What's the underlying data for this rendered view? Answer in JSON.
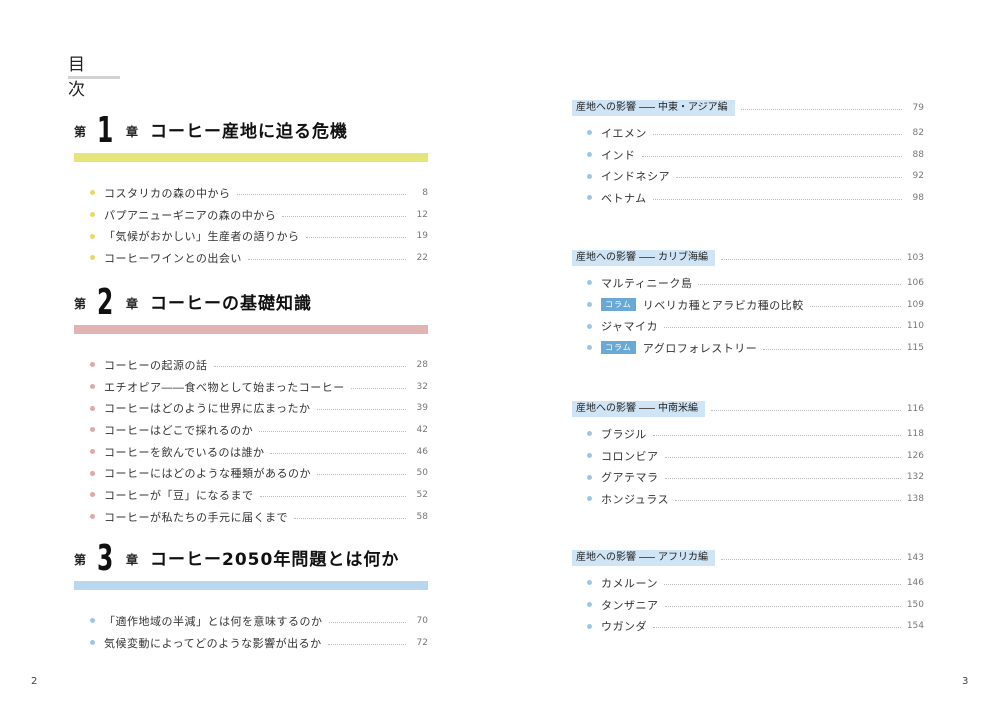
{
  "toc_title": "目 次",
  "colors": {
    "ch1": "#e6e57a",
    "ch2": "#e2b3b3",
    "ch3": "#b9d8ef",
    "ch1_dot": "#e8d86a",
    "ch2_dot": "#e2a6a6",
    "ch3_dot": "#9cc6e8",
    "region_bg": "#cfe4f4",
    "badge": "#6aa8d6"
  },
  "chapters": [
    {
      "dai": "第",
      "num": "1",
      "sho": "章",
      "title": "コーヒー産地に迫る危機",
      "items": [
        {
          "label": "コスタリカの森の中から",
          "page": "8"
        },
        {
          "label": "パプアニューギニアの森の中から",
          "page": "12"
        },
        {
          "label": "「気候がおかしい」生産者の語りから",
          "page": "19"
        },
        {
          "label": "コーヒーワインとの出会い",
          "page": "22"
        }
      ]
    },
    {
      "dai": "第",
      "num": "2",
      "sho": "章",
      "title": "コーヒーの基礎知識",
      "items": [
        {
          "label": "コーヒーの起源の話",
          "page": "28"
        },
        {
          "label": "エチオピア――食べ物として始まったコーヒー",
          "page": "32"
        },
        {
          "label": "コーヒーはどのように世界に広まったか",
          "page": "39"
        },
        {
          "label": "コーヒーはどこで採れるのか",
          "page": "42"
        },
        {
          "label": "コーヒーを飲んでいるのは誰か",
          "page": "46"
        },
        {
          "label": "コーヒーにはどのような種類があるのか",
          "page": "50"
        },
        {
          "label": "コーヒーが「豆」になるまで",
          "page": "52"
        },
        {
          "label": "コーヒーが私たちの手元に届くまで",
          "page": "58"
        }
      ]
    },
    {
      "dai": "第",
      "num": "3",
      "sho": "章",
      "title": "コーヒー2050年問題とは何か",
      "items": [
        {
          "label": "「適作地域の半減」とは何を意味するのか",
          "page": "70"
        },
        {
          "label": "気候変動によってどのような影響が出るか",
          "page": "72"
        }
      ]
    }
  ],
  "regions": [
    {
      "prefix": "産地への影響",
      "name": "中東・アジア編",
      "page": "79",
      "items": [
        {
          "badge": "",
          "label": "イエメン",
          "page": "82"
        },
        {
          "badge": "",
          "label": "インド",
          "page": "88"
        },
        {
          "badge": "",
          "label": "インドネシア",
          "page": "92"
        },
        {
          "badge": "",
          "label": "ベトナム",
          "page": "98"
        }
      ]
    },
    {
      "prefix": "産地への影響",
      "name": "カリブ海編",
      "page": "103",
      "items": [
        {
          "badge": "",
          "label": "マルティニーク島",
          "page": "106"
        },
        {
          "badge": "コラム",
          "label": "リベリカ種とアラビカ種の比較",
          "page": "109"
        },
        {
          "badge": "",
          "label": "ジャマイカ",
          "page": "110"
        },
        {
          "badge": "コラム",
          "label": "アグロフォレストリー",
          "page": "115"
        }
      ]
    },
    {
      "prefix": "産地への影響",
      "name": "中南米編",
      "page": "116",
      "items": [
        {
          "badge": "",
          "label": "ブラジル",
          "page": "118"
        },
        {
          "badge": "",
          "label": "コロンビア",
          "page": "126"
        },
        {
          "badge": "",
          "label": "グアテマラ",
          "page": "132"
        },
        {
          "badge": "",
          "label": "ホンジュラス",
          "page": "138"
        }
      ]
    },
    {
      "prefix": "産地への影響",
      "name": "アフリカ編",
      "page": "143",
      "items": [
        {
          "badge": "",
          "label": "カメルーン",
          "page": "146"
        },
        {
          "badge": "",
          "label": "タンザニア",
          "page": "150"
        },
        {
          "badge": "",
          "label": "ウガンダ",
          "page": "154"
        }
      ]
    }
  ],
  "page_numbers": {
    "left": "2",
    "right": "3"
  }
}
